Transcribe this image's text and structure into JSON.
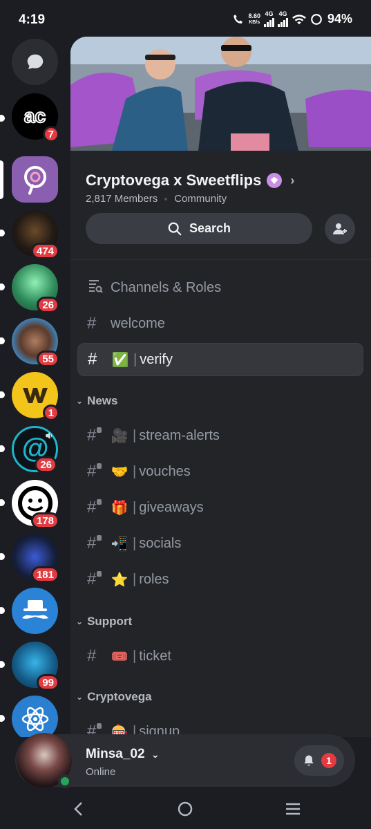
{
  "status_bar": {
    "time": "4:19",
    "net_speed": "8.60",
    "net_unit": "KB/s",
    "net1": "4G",
    "net2": "4G",
    "battery": "94%"
  },
  "servers": [
    {
      "name": "dm",
      "badge": ""
    },
    {
      "name": "ac",
      "badge": "7"
    },
    {
      "name": "cryptovega-sweetflips",
      "badge": ""
    },
    {
      "name": "server-3",
      "badge": "474"
    },
    {
      "name": "server-4",
      "badge": "26"
    },
    {
      "name": "server-5",
      "badge": "55"
    },
    {
      "name": "server-6",
      "badge": "1"
    },
    {
      "name": "server-7",
      "badge": "26"
    },
    {
      "name": "server-8",
      "badge": "178"
    },
    {
      "name": "server-9",
      "badge": "181"
    },
    {
      "name": "server-10",
      "badge": ""
    },
    {
      "name": "server-11",
      "badge": "99"
    },
    {
      "name": "server-12",
      "badge": ""
    }
  ],
  "server": {
    "name": "Cryptovega x Sweetflips",
    "members": "2,817 Members",
    "type": "Community",
    "search_label": "Search"
  },
  "channels": {
    "channels_roles": "Channels & Roles",
    "welcome": "welcome",
    "verify": "verify",
    "cat_news": "News",
    "stream_alerts": "stream-alerts",
    "vouches": "vouches",
    "giveaways": "giveaways",
    "socials": "socials",
    "roles": "roles",
    "cat_support": "Support",
    "ticket": "ticket",
    "cat_cryptovega": "Cryptovega",
    "signup": "signup"
  },
  "emoji": {
    "verify": "✅",
    "stream_alerts": "🎥",
    "vouches": "🤝",
    "giveaways": "🎁",
    "socials": "📲",
    "roles": "⭐",
    "ticket": "🎟️",
    "signup": "🎰"
  },
  "user": {
    "name": "Minsa_02",
    "status": "Online",
    "notif_count": "1"
  },
  "colors": {
    "accent_red": "#e23b41",
    "online_green": "#23a55a",
    "boost_pink": "#c98ee6"
  }
}
